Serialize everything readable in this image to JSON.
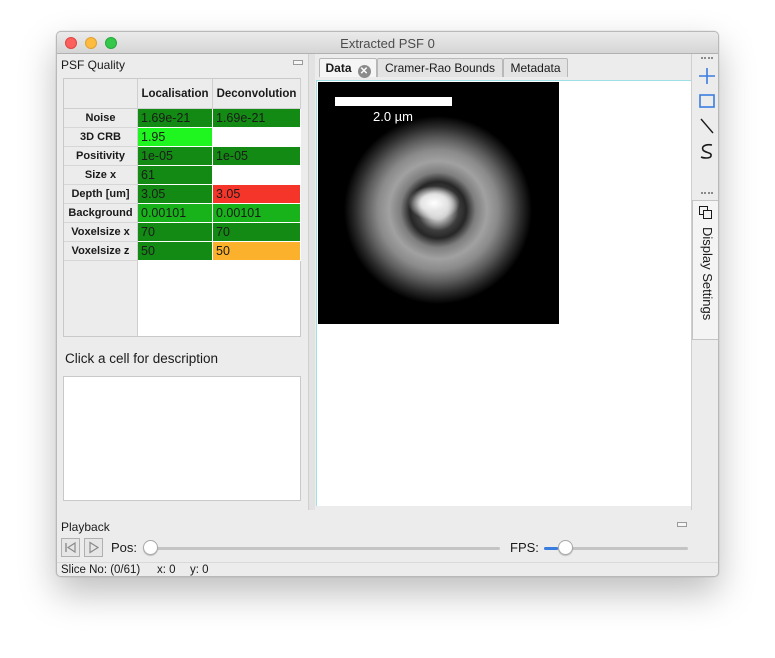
{
  "window": {
    "title": "Extracted PSF 0"
  },
  "quality_panel": {
    "title": "PSF Quality",
    "columns": [
      "Localisation",
      "Deconvolution"
    ],
    "rows": [
      {
        "label": "Noise",
        "values": [
          "1.69e-21",
          "1.69e-21"
        ],
        "colors": [
          "#138a13",
          "#138a13"
        ]
      },
      {
        "label": "3D CRB",
        "values": [
          "1.95",
          ""
        ],
        "colors": [
          "#1ff51f",
          "#ffffff"
        ]
      },
      {
        "label": "Positivity",
        "values": [
          "1e-05",
          "1e-05"
        ],
        "colors": [
          "#138a13",
          "#138a13"
        ]
      },
      {
        "label": "Size x",
        "values": [
          "61",
          ""
        ],
        "colors": [
          "#138a13",
          "#ffffff"
        ]
      },
      {
        "label": "Depth [um]",
        "values": [
          "3.05",
          "3.05"
        ],
        "colors": [
          "#138a13",
          "#f5352a"
        ]
      },
      {
        "label": "Background",
        "values": [
          "0.00101",
          "0.00101"
        ],
        "colors": [
          "#18b21b",
          "#18b21b"
        ]
      },
      {
        "label": "Voxelsize x",
        "values": [
          "70",
          "70"
        ],
        "colors": [
          "#138a13",
          "#138a13"
        ]
      },
      {
        "label": "Voxelsize z",
        "values": [
          "50",
          "50"
        ],
        "colors": [
          "#138a13",
          "#fbb12c"
        ]
      }
    ],
    "description_prompt": "Click a cell for description",
    "description_text": ""
  },
  "tabs": [
    {
      "label": "Data",
      "closable": true,
      "active": true
    },
    {
      "label": "Cramer-Rao Bounds",
      "closable": false,
      "active": false
    },
    {
      "label": "Metadata",
      "closable": false,
      "active": false
    }
  ],
  "image": {
    "scalebar_label": "2.0 µm"
  },
  "toolbar": {
    "tools": [
      "crosshair-icon",
      "rectangle-icon",
      "line-icon",
      "freehand-icon"
    ],
    "settings_icon": "copy-icon",
    "display_settings_label": "Display Settings"
  },
  "playback": {
    "title": "Playback",
    "pos_label": "Pos:",
    "fps_label": "FPS:",
    "pos_value": 0,
    "fps_fraction": 0.1,
    "buttons": [
      "skip-back-icon",
      "play-icon"
    ]
  },
  "status": {
    "slice": "Slice No: (0/61)",
    "x": "x: 0",
    "y": "y: 0"
  },
  "colors": {
    "accent": "#3a7de0",
    "canvas_border": "#9fe0e6"
  }
}
